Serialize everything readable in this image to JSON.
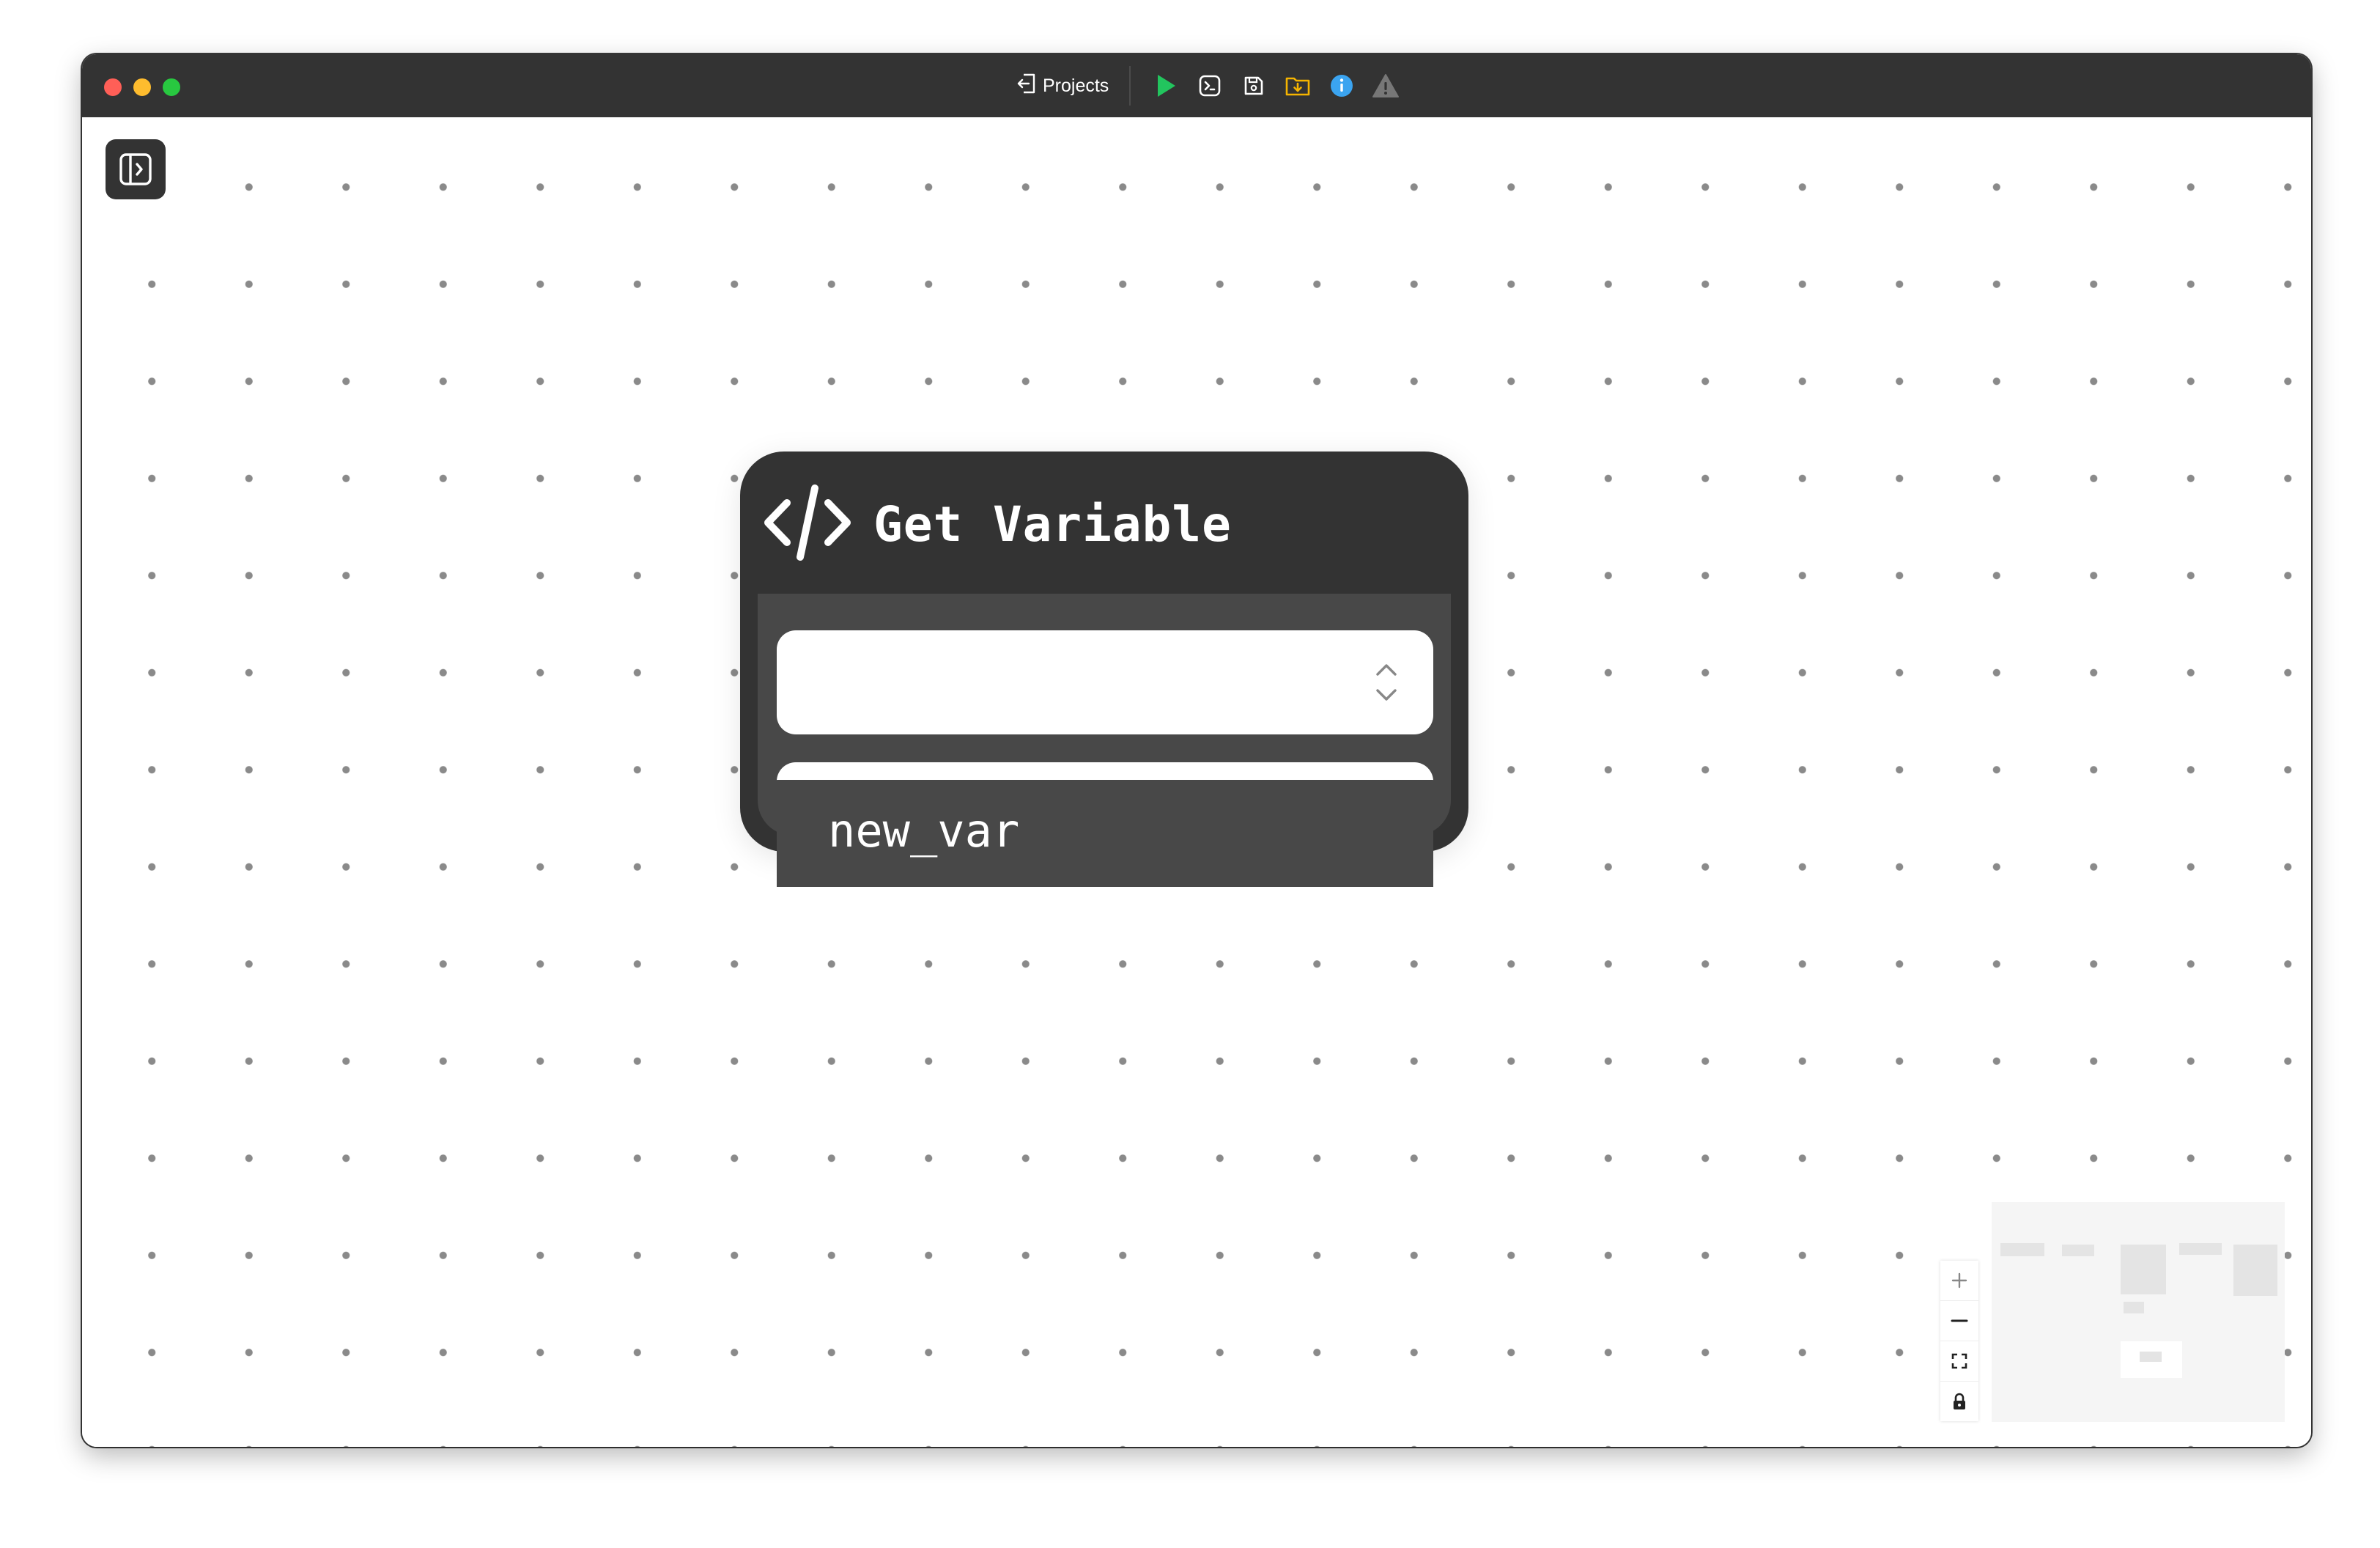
{
  "window": {
    "traffic_lights": [
      "close",
      "minimize",
      "zoom"
    ]
  },
  "toolbar": {
    "projects_label": "Projects",
    "icons": [
      "run-icon",
      "terminal-icon",
      "save-icon",
      "export-folder-icon",
      "info-icon",
      "warning-icon"
    ],
    "colors": {
      "run": "#22c55e",
      "export": "#f5b400",
      "info": "#3ba4f0",
      "warning": "#777777"
    }
  },
  "sidebar": {
    "toggle_icon": "sidebar-toggle-icon"
  },
  "node": {
    "icon": "code-icon",
    "title": "Get Variable",
    "select_value": "",
    "dropdown_options": [
      "new_var"
    ]
  },
  "controls": {
    "items": [
      "zoom-in-icon",
      "zoom-out-icon",
      "fit-view-icon",
      "lock-icon"
    ]
  }
}
